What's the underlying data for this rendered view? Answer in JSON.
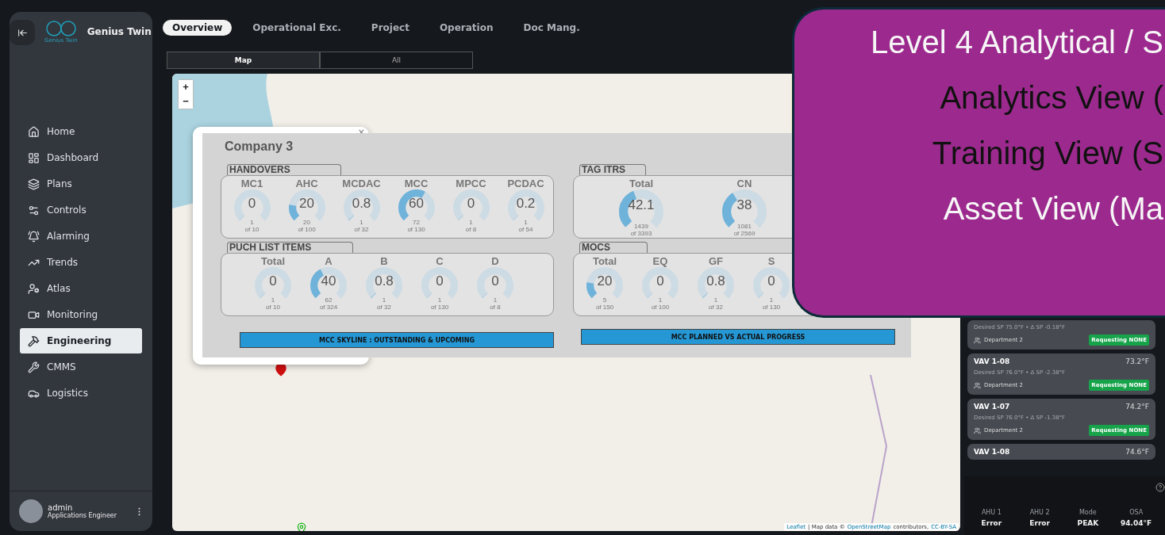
{
  "sidebar": {
    "brand": "Genius Twin",
    "logo_text": "Genius Twin",
    "items": [
      {
        "label": "Home",
        "selected": false
      },
      {
        "label": "Dashboard",
        "selected": false
      },
      {
        "label": "Plans",
        "selected": false
      },
      {
        "label": "Controls",
        "selected": false
      },
      {
        "label": "Alarming",
        "selected": false
      },
      {
        "label": "Trends",
        "selected": false
      },
      {
        "label": "Atlas",
        "selected": false
      },
      {
        "label": "Monitoring",
        "selected": false
      },
      {
        "label": "Engineering",
        "selected": true
      },
      {
        "label": "CMMS",
        "selected": false
      },
      {
        "label": "Logistics",
        "selected": false
      }
    ],
    "user": {
      "name": "admin",
      "role": "Applications Engineer"
    }
  },
  "top_tabs": [
    {
      "label": "Overview",
      "selected": true
    },
    {
      "label": "Operational Exc.",
      "selected": false
    },
    {
      "label": "Project",
      "selected": false
    },
    {
      "label": "Operation",
      "selected": false
    },
    {
      "label": "Doc Mang.",
      "selected": false
    }
  ],
  "view_tabs": [
    {
      "label": "Map",
      "selected": true
    },
    {
      "label": "All",
      "selected": false
    }
  ],
  "map": {
    "zoom_in": "+",
    "zoom_out": "−",
    "attribution": {
      "leaflet": "Leaflet",
      "text": "| Map data ©",
      "osm": "OpenStreetMap",
      "contributors": "contributors,",
      "license": "CC-BY-SA"
    }
  },
  "popup": {
    "title": "Company 3",
    "close": "×",
    "groups": [
      {
        "title": "HANDOVERS",
        "kind": "small",
        "gauges": [
          {
            "label": "MC1",
            "value": "0",
            "count": "1",
            "total": "of 10",
            "level": 0.0
          },
          {
            "label": "AHC",
            "value": "20",
            "count": "20",
            "total": "of 100",
            "level": 0.2
          },
          {
            "label": "MCDAC",
            "value": "0.8",
            "count": "1",
            "total": "of 32",
            "level": 0.008
          },
          {
            "label": "MCC",
            "value": "60",
            "count": "72",
            "total": "of 130",
            "level": 0.6
          },
          {
            "label": "MPCC",
            "value": "0",
            "count": "1",
            "total": "of 8",
            "level": 0.0
          },
          {
            "label": "PCDAC",
            "value": "0.2",
            "count": "1",
            "total": "of 54",
            "level": 0.002
          }
        ]
      },
      {
        "title": "TAG ITRS",
        "kind": "large",
        "gauges": [
          {
            "label": "Total",
            "value": "42.1",
            "count": "1439",
            "total": "of 3393",
            "level": 0.421
          },
          {
            "label": "CN",
            "value": "38",
            "count": "1081",
            "total": "of 2569",
            "level": 0.38
          }
        ]
      },
      {
        "title": "PUCH LIST ITEMS",
        "kind": "small",
        "gauges": [
          {
            "label": "Total",
            "value": "0",
            "count": "1",
            "total": "of 10",
            "level": 0.0
          },
          {
            "label": "A",
            "value": "40",
            "count": "62",
            "total": "of 324",
            "level": 0.4
          },
          {
            "label": "B",
            "value": "0.8",
            "count": "1",
            "total": "of 32",
            "level": 0.008
          },
          {
            "label": "C",
            "value": "0",
            "count": "1",
            "total": "of 130",
            "level": 0.0
          },
          {
            "label": "D",
            "value": "0",
            "count": "1",
            "total": "of 8",
            "level": 0.0
          }
        ]
      },
      {
        "title": "MOCS",
        "kind": "small",
        "gauges": [
          {
            "label": "Total",
            "value": "20",
            "count": "5",
            "total": "of 150",
            "level": 0.2
          },
          {
            "label": "EQ",
            "value": "0",
            "count": "1",
            "total": "of 100",
            "level": 0.0
          },
          {
            "label": "GF",
            "value": "0.8",
            "count": "1",
            "total": "of 32",
            "level": 0.008
          },
          {
            "label": "S",
            "value": "0",
            "count": "1",
            "total": "of 130",
            "level": 0.0
          }
        ]
      }
    ],
    "buttons": [
      "MCC SKYLINE : OUTSTANDING & UPCOMING",
      "MCC PLANNED VS ACTUAL PROGRESS"
    ]
  },
  "vav_cards": [
    {
      "kind": "tail",
      "desired_label": "Desired SP",
      "desired": "75.0°F",
      "separator": "•",
      "delta_label": "Δ SP",
      "delta": "-0.18°F",
      "department": "Department 2",
      "status": "Requesting NONE"
    },
    {
      "kind": "full",
      "name": "VAV 1-08",
      "temp": "73.2°F",
      "desired_label": "Desired SP",
      "desired": "76.0°F",
      "separator": "•",
      "delta_label": "Δ SP",
      "delta": "-2.38°F",
      "department": "Department 2",
      "status": "Requesting NONE"
    },
    {
      "kind": "full",
      "name": "VAV 1-07",
      "temp": "74.2°F",
      "desired_label": "Desired SP",
      "desired": "76.0°F",
      "separator": "•",
      "delta_label": "Δ SP",
      "delta": "-1.38°F",
      "department": "Department 2",
      "status": "Requesting NONE"
    },
    {
      "kind": "head",
      "name": "VAV 1-08",
      "temp": "74.6°F"
    }
  ],
  "stats": [
    {
      "label": "AHU 1",
      "value": "Error"
    },
    {
      "label": "AHU 2",
      "value": "Error"
    },
    {
      "label": "Mode",
      "value": "PEAK"
    },
    {
      "label": "OSA",
      "value": "94.04°F"
    }
  ],
  "overlay": {
    "lines": [
      "Level 4 Analytical / S",
      "Analytics View (",
      "Training View (S",
      "Asset View (Ma"
    ]
  }
}
